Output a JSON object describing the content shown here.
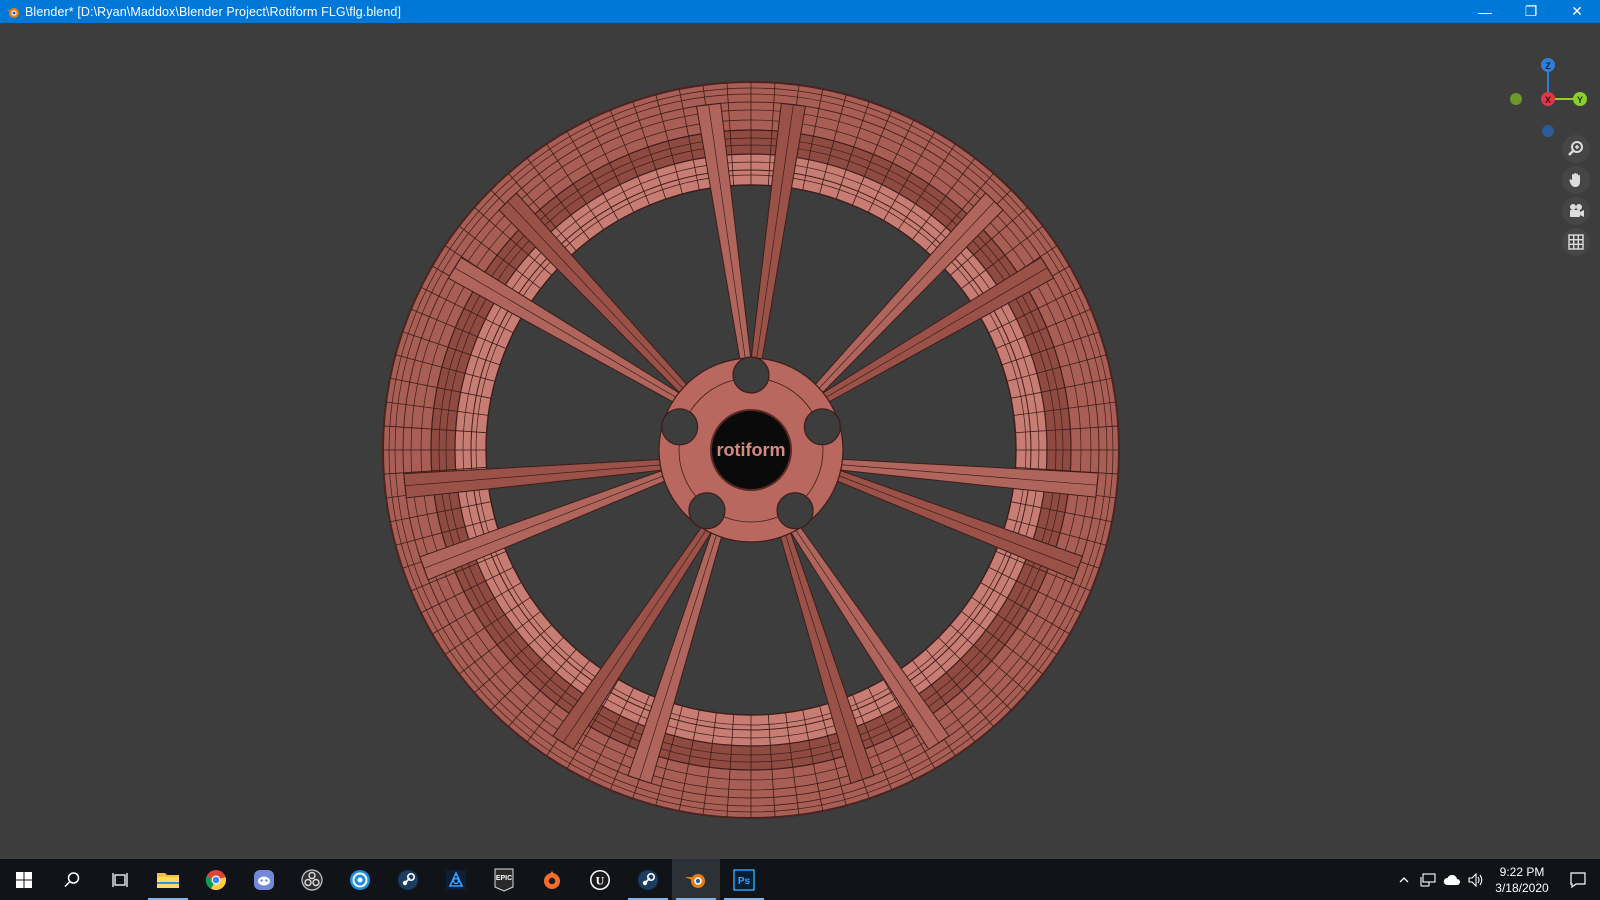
{
  "window": {
    "title": "Blender* [D:\\Ryan\\Maddox\\Blender Project\\Rotiform FLG\\flg.blend]",
    "minimize_glyph": "—",
    "maximize_glyph": "❐",
    "close_glyph": "✕"
  },
  "viewport": {
    "background": "#3d3d3d",
    "wheel_color": "#c2756e",
    "center_cap_text": "rotiform",
    "gizmo": {
      "z_label": "Z",
      "x_label": "X",
      "y_label": "Y"
    },
    "tools": [
      {
        "name": "zoom-icon"
      },
      {
        "name": "hand-pan-icon"
      },
      {
        "name": "camera-icon"
      },
      {
        "name": "grid-icon"
      }
    ]
  },
  "taskbar": {
    "apps": [
      {
        "name": "start-icon"
      },
      {
        "name": "search-icon"
      },
      {
        "name": "task-view-icon"
      },
      {
        "name": "file-explorer-icon"
      },
      {
        "name": "chrome-icon"
      },
      {
        "name": "discord-icon"
      },
      {
        "name": "obs-icon"
      },
      {
        "name": "uplay-icon"
      },
      {
        "name": "steam-icon"
      },
      {
        "name": "battlenet-icon"
      },
      {
        "name": "epic-games-icon",
        "text": "EPIC"
      },
      {
        "name": "origin-icon"
      },
      {
        "name": "unreal-engine-icon",
        "text": "U"
      },
      {
        "name": "steam-icon"
      },
      {
        "name": "blender-icon"
      },
      {
        "name": "photoshop-icon",
        "text": "Ps"
      }
    ],
    "clock": {
      "time": "9:22 PM",
      "date": "3/18/2020"
    }
  }
}
